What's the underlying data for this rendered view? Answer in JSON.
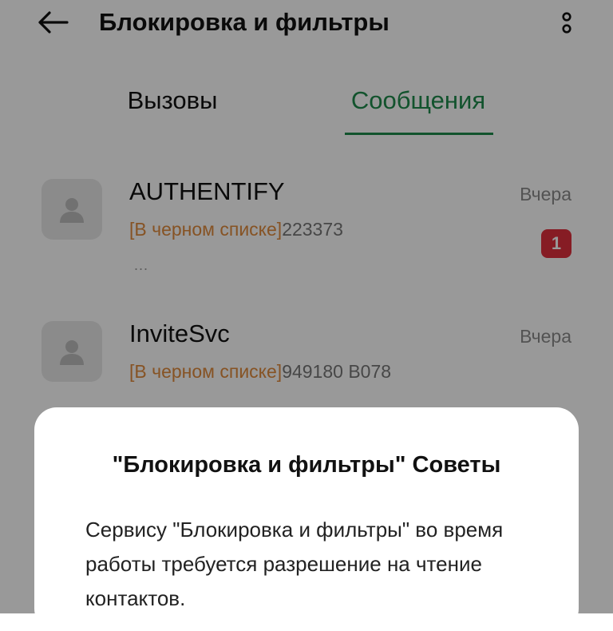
{
  "header": {
    "title": "Блокировка и фильтры",
    "back_icon": "arrow-left-icon",
    "more_icon": "more-vertical-icon"
  },
  "tabs": [
    {
      "label": "Вызовы",
      "selected": false
    },
    {
      "label": "Сообщения",
      "selected": true
    }
  ],
  "messages": [
    {
      "sender": "AUTHENTIFY",
      "tag": "[В черном списке]",
      "preview": "223373",
      "more": "...",
      "time": "Вчера",
      "unread": "1"
    },
    {
      "sender": "InviteSvc",
      "tag": "[В черном списке]",
      "preview": "949180 B078",
      "time": "Вчера"
    }
  ],
  "dialog": {
    "title": "\"Блокировка и фильтры\" Советы",
    "body": "Сервису \"Блокировка и фильтры\" во время работы требуется разрешение на чтение контактов."
  },
  "colors": {
    "accent": "#1f8a4c",
    "blacklist_tag": "#e08a3c",
    "badge": "#e0303c",
    "scrim": "rgba(0,0,0,0.40)"
  }
}
